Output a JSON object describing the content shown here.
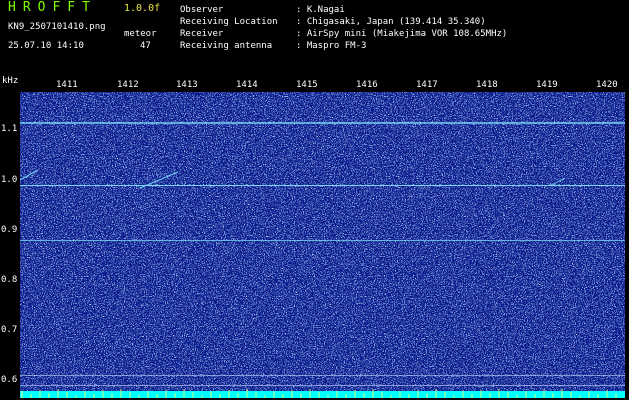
{
  "header": {
    "brand": "HROFFT",
    "version": "1.0.0f",
    "filename": "KN9_2507101410.png",
    "mode": "meteor",
    "datetime": "25.07.10 14:10",
    "count": "47",
    "info": [
      {
        "key": "Observer",
        "value": ": K.Nagai"
      },
      {
        "key": "Receiving Location",
        "value": ": Chigasaki, Japan (139.414 35.340)"
      },
      {
        "key": "Receiver",
        "value": ": AirSpy mini (Miakejima VOR 108.65MHz)"
      },
      {
        "key": "Receiving antenna",
        "value": ": Maspro FM-3"
      }
    ]
  },
  "time_axis": {
    "unit": "kHz",
    "labels": [
      "1411",
      "1412",
      "1413",
      "1414",
      "1415",
      "1416",
      "1417",
      "1418",
      "1419",
      "1420"
    ]
  },
  "freq_axis": {
    "labels": [
      "1.1",
      "1.0",
      "0.9",
      "0.8",
      "0.7",
      "0.6"
    ],
    "values": [
      1.1,
      1.0,
      0.9,
      0.8,
      0.7,
      0.6
    ]
  },
  "colors": {
    "background": "#0a1a8c",
    "noise_light": "#9fd8ff",
    "noise_dark": "#2d54d8",
    "carrier": "#7fe8ff",
    "floor": "#00ffff",
    "brand": "#7cff00",
    "version": "#e8e84a"
  },
  "carriers_khz": [
    1.12,
    0.995,
    0.885
  ],
  "floor_lines_khz": [
    0.615,
    0.595
  ]
}
